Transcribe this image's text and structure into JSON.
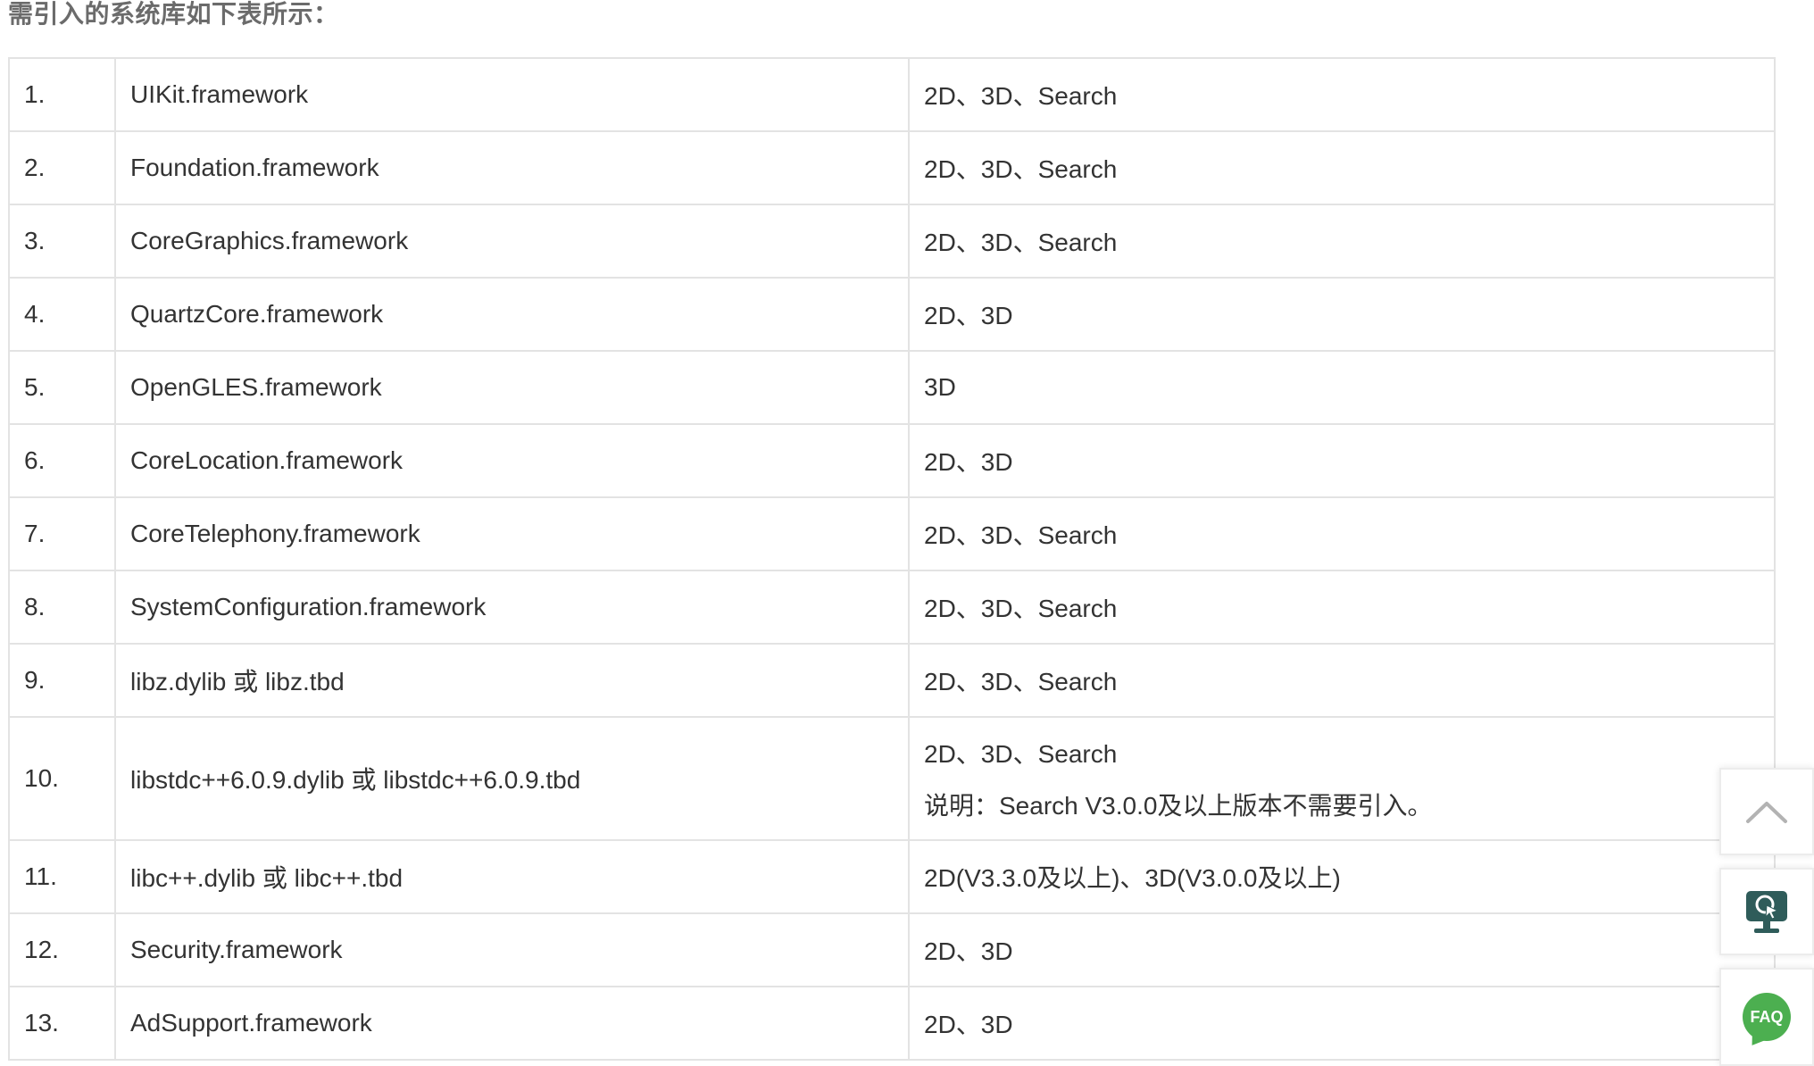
{
  "intro": "需引入的系统库如下表所示：",
  "rows": [
    {
      "num": "1.",
      "name": "UIKit.framework",
      "use": "2D、3D、Search"
    },
    {
      "num": "2.",
      "name": "Foundation.framework",
      "use": "2D、3D、Search"
    },
    {
      "num": "3.",
      "name": "CoreGraphics.framework",
      "use": "2D、3D、Search"
    },
    {
      "num": "4.",
      "name": "QuartzCore.framework",
      "use": "2D、3D"
    },
    {
      "num": "5.",
      "name": "OpenGLES.framework",
      "use": "3D"
    },
    {
      "num": "6.",
      "name": "CoreLocation.framework",
      "use": "2D、3D"
    },
    {
      "num": "7.",
      "name": "CoreTelephony.framework",
      "use": "2D、3D、Search"
    },
    {
      "num": "8.",
      "name": "SystemConfiguration.framework",
      "use": "2D、3D、Search"
    },
    {
      "num": "9.",
      "name": "libz.dylib 或 libz.tbd",
      "use": "2D、3D、Search"
    },
    {
      "num": "10.",
      "name": "libstdc++6.0.9.dylib 或 libstdc++6.0.9.tbd",
      "use": "2D、3D、Search",
      "note": "说明：Search V3.0.0及以上版本不需要引入。"
    },
    {
      "num": "11.",
      "name": "libc++.dylib 或 libc++.tbd",
      "use": "2D(V3.3.0及以上)、3D(V3.0.0及以上)"
    },
    {
      "num": "12.",
      "name": "Security.framework",
      "use": "2D、3D"
    },
    {
      "num": "13.",
      "name": "AdSupport.framework",
      "use": "2D、3D"
    }
  ],
  "highlight_color": "#c8322a",
  "side_tools": {
    "back_to_top_icon": "chevron-up-icon",
    "feedback_icon": "monitor-cursor-icon",
    "faq_label": "FAQ",
    "faq_color": "#4caf50"
  }
}
